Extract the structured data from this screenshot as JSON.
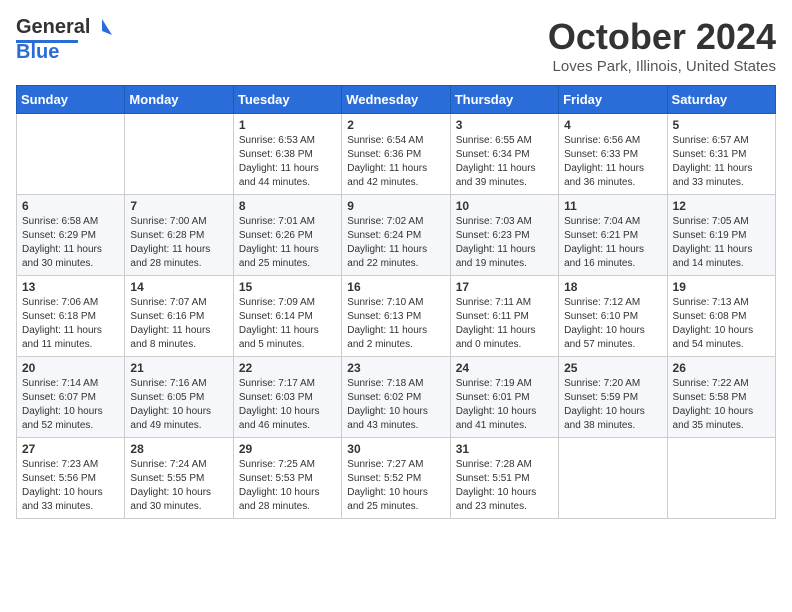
{
  "header": {
    "logo_general": "General",
    "logo_blue": "Blue",
    "month": "October 2024",
    "location": "Loves Park, Illinois, United States"
  },
  "weekdays": [
    "Sunday",
    "Monday",
    "Tuesday",
    "Wednesday",
    "Thursday",
    "Friday",
    "Saturday"
  ],
  "weeks": [
    [
      {
        "day": "",
        "info": ""
      },
      {
        "day": "",
        "info": ""
      },
      {
        "day": "1",
        "info": "Sunrise: 6:53 AM\nSunset: 6:38 PM\nDaylight: 11 hours\nand 44 minutes."
      },
      {
        "day": "2",
        "info": "Sunrise: 6:54 AM\nSunset: 6:36 PM\nDaylight: 11 hours\nand 42 minutes."
      },
      {
        "day": "3",
        "info": "Sunrise: 6:55 AM\nSunset: 6:34 PM\nDaylight: 11 hours\nand 39 minutes."
      },
      {
        "day": "4",
        "info": "Sunrise: 6:56 AM\nSunset: 6:33 PM\nDaylight: 11 hours\nand 36 minutes."
      },
      {
        "day": "5",
        "info": "Sunrise: 6:57 AM\nSunset: 6:31 PM\nDaylight: 11 hours\nand 33 minutes."
      }
    ],
    [
      {
        "day": "6",
        "info": "Sunrise: 6:58 AM\nSunset: 6:29 PM\nDaylight: 11 hours\nand 30 minutes."
      },
      {
        "day": "7",
        "info": "Sunrise: 7:00 AM\nSunset: 6:28 PM\nDaylight: 11 hours\nand 28 minutes."
      },
      {
        "day": "8",
        "info": "Sunrise: 7:01 AM\nSunset: 6:26 PM\nDaylight: 11 hours\nand 25 minutes."
      },
      {
        "day": "9",
        "info": "Sunrise: 7:02 AM\nSunset: 6:24 PM\nDaylight: 11 hours\nand 22 minutes."
      },
      {
        "day": "10",
        "info": "Sunrise: 7:03 AM\nSunset: 6:23 PM\nDaylight: 11 hours\nand 19 minutes."
      },
      {
        "day": "11",
        "info": "Sunrise: 7:04 AM\nSunset: 6:21 PM\nDaylight: 11 hours\nand 16 minutes."
      },
      {
        "day": "12",
        "info": "Sunrise: 7:05 AM\nSunset: 6:19 PM\nDaylight: 11 hours\nand 14 minutes."
      }
    ],
    [
      {
        "day": "13",
        "info": "Sunrise: 7:06 AM\nSunset: 6:18 PM\nDaylight: 11 hours\nand 11 minutes."
      },
      {
        "day": "14",
        "info": "Sunrise: 7:07 AM\nSunset: 6:16 PM\nDaylight: 11 hours\nand 8 minutes."
      },
      {
        "day": "15",
        "info": "Sunrise: 7:09 AM\nSunset: 6:14 PM\nDaylight: 11 hours\nand 5 minutes."
      },
      {
        "day": "16",
        "info": "Sunrise: 7:10 AM\nSunset: 6:13 PM\nDaylight: 11 hours\nand 2 minutes."
      },
      {
        "day": "17",
        "info": "Sunrise: 7:11 AM\nSunset: 6:11 PM\nDaylight: 11 hours\nand 0 minutes."
      },
      {
        "day": "18",
        "info": "Sunrise: 7:12 AM\nSunset: 6:10 PM\nDaylight: 10 hours\nand 57 minutes."
      },
      {
        "day": "19",
        "info": "Sunrise: 7:13 AM\nSunset: 6:08 PM\nDaylight: 10 hours\nand 54 minutes."
      }
    ],
    [
      {
        "day": "20",
        "info": "Sunrise: 7:14 AM\nSunset: 6:07 PM\nDaylight: 10 hours\nand 52 minutes."
      },
      {
        "day": "21",
        "info": "Sunrise: 7:16 AM\nSunset: 6:05 PM\nDaylight: 10 hours\nand 49 minutes."
      },
      {
        "day": "22",
        "info": "Sunrise: 7:17 AM\nSunset: 6:03 PM\nDaylight: 10 hours\nand 46 minutes."
      },
      {
        "day": "23",
        "info": "Sunrise: 7:18 AM\nSunset: 6:02 PM\nDaylight: 10 hours\nand 43 minutes."
      },
      {
        "day": "24",
        "info": "Sunrise: 7:19 AM\nSunset: 6:01 PM\nDaylight: 10 hours\nand 41 minutes."
      },
      {
        "day": "25",
        "info": "Sunrise: 7:20 AM\nSunset: 5:59 PM\nDaylight: 10 hours\nand 38 minutes."
      },
      {
        "day": "26",
        "info": "Sunrise: 7:22 AM\nSunset: 5:58 PM\nDaylight: 10 hours\nand 35 minutes."
      }
    ],
    [
      {
        "day": "27",
        "info": "Sunrise: 7:23 AM\nSunset: 5:56 PM\nDaylight: 10 hours\nand 33 minutes."
      },
      {
        "day": "28",
        "info": "Sunrise: 7:24 AM\nSunset: 5:55 PM\nDaylight: 10 hours\nand 30 minutes."
      },
      {
        "day": "29",
        "info": "Sunrise: 7:25 AM\nSunset: 5:53 PM\nDaylight: 10 hours\nand 28 minutes."
      },
      {
        "day": "30",
        "info": "Sunrise: 7:27 AM\nSunset: 5:52 PM\nDaylight: 10 hours\nand 25 minutes."
      },
      {
        "day": "31",
        "info": "Sunrise: 7:28 AM\nSunset: 5:51 PM\nDaylight: 10 hours\nand 23 minutes."
      },
      {
        "day": "",
        "info": ""
      },
      {
        "day": "",
        "info": ""
      }
    ]
  ]
}
